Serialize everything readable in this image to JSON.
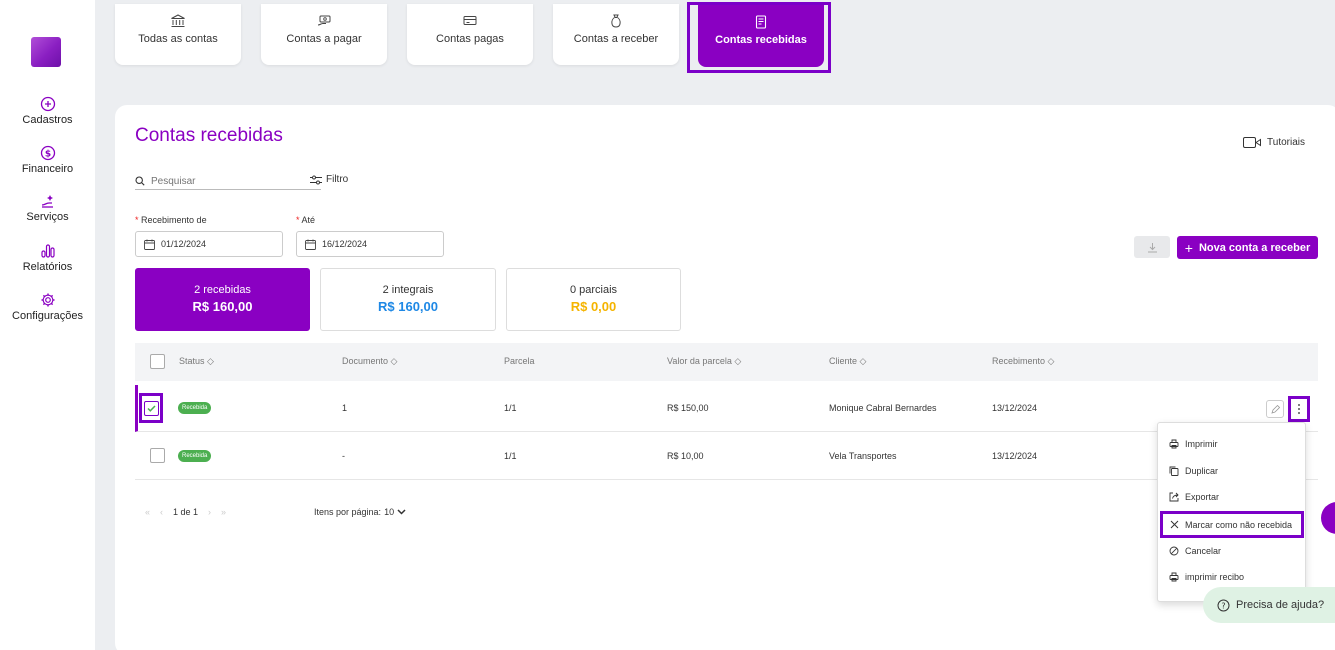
{
  "sidebar": {
    "items": [
      {
        "label": "Cadastros",
        "icon": "plus-circle-icon"
      },
      {
        "label": "Financeiro",
        "icon": "dollar-circle-icon"
      },
      {
        "label": "Serviços",
        "icon": "hand-sparkle-icon"
      },
      {
        "label": "Relatórios",
        "icon": "bar-chart-icon"
      },
      {
        "label": "Configurações",
        "icon": "gear-icon"
      }
    ]
  },
  "tabs": [
    {
      "label": "Todas as contas",
      "icon": "bank-icon"
    },
    {
      "label": "Contas a pagar",
      "icon": "cash-hand-icon"
    },
    {
      "label": "Contas pagas",
      "icon": "card-icon"
    },
    {
      "label": "Contas a receber",
      "icon": "money-bag-icon"
    },
    {
      "label": "Contas recebidas",
      "icon": "receipt-icon",
      "active": true
    }
  ],
  "main": {
    "title": "Contas recebidas",
    "tutorials_label": "Tutoriais",
    "search_placeholder": "Pesquisar",
    "filter_label": "Filtro",
    "date_from_label": "Recebimento de",
    "date_from_value": "01/12/2024",
    "date_to_label": "Até",
    "date_to_value": "16/12/2024",
    "required_mark": "*",
    "new_button_label": "Nova conta a receber",
    "stats": [
      {
        "label": "2 recebidas",
        "value": "R$ 160,00",
        "color": "#ffffff"
      },
      {
        "label": "2 integrais",
        "value": "R$ 160,00",
        "color": "#1e88e5"
      },
      {
        "label": "0 parciais",
        "value": "R$ 0,00",
        "color": "#f5b400"
      }
    ]
  },
  "table": {
    "headers": {
      "status": "Status ◇",
      "documento": "Documento ◇",
      "parcela": "Parcela",
      "valor": "Valor da parcela ◇",
      "cliente": "Cliente ◇",
      "recebimento": "Recebimento ◇"
    },
    "rows": [
      {
        "status": "Recebida",
        "documento": "1",
        "parcela": "1/1",
        "valor": "R$ 150,00",
        "cliente": "Monique Cabral Bernardes",
        "recebimento": "13/12/2024",
        "checked": true
      },
      {
        "status": "Recebida",
        "documento": "-",
        "parcela": "1/1",
        "valor": "R$ 10,00",
        "cliente": "Vela Transportes",
        "recebimento": "13/12/2024",
        "checked": false
      }
    ]
  },
  "pager": {
    "page_text": "1 de 1",
    "per_page_label": "Itens por página:",
    "per_page_value": "10"
  },
  "menu": {
    "items": [
      {
        "label": "Imprimir",
        "icon": "print-icon"
      },
      {
        "label": "Duplicar",
        "icon": "copy-icon"
      },
      {
        "label": "Exportar",
        "icon": "export-icon"
      },
      {
        "label": "Marcar como não recebida",
        "icon": "x-icon",
        "highlighted": true
      },
      {
        "label": "Cancelar",
        "icon": "ban-icon"
      },
      {
        "label": "imprimir recibo",
        "icon": "print-icon"
      }
    ]
  },
  "help": {
    "label": "Precisa de ajuda?"
  },
  "colors": {
    "accent": "#8a00c2",
    "success": "#4caf50",
    "highlight": "#7b00c8"
  }
}
